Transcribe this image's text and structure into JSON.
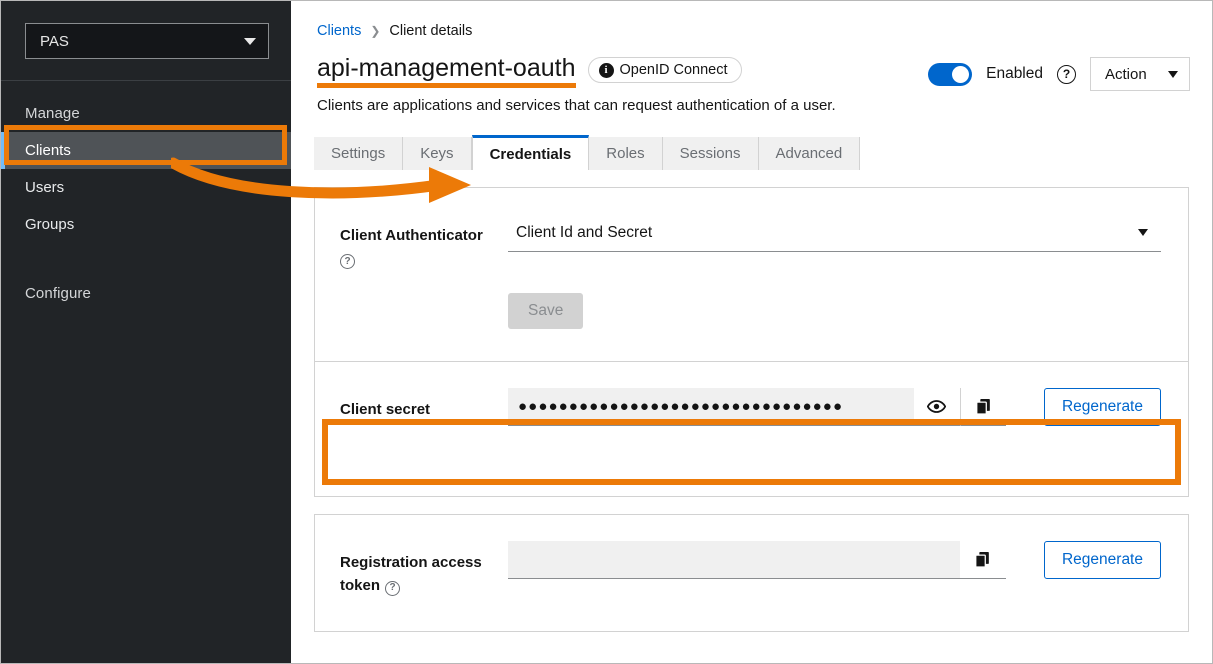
{
  "sidebar": {
    "realm_select": {
      "value": "PAS",
      "icon": "chevron-down-icon"
    },
    "section_label": "Manage",
    "items": [
      {
        "label": "Clients",
        "active": true
      },
      {
        "label": "Users",
        "active": false
      },
      {
        "label": "Groups",
        "active": false
      }
    ],
    "configure_label": "Configure"
  },
  "breadcrumb": {
    "root": "Clients",
    "separator": "❯",
    "current": "Client details"
  },
  "header": {
    "title": "api-management-oauth",
    "badge": {
      "icon": "info-icon",
      "label": "OpenID Connect"
    },
    "toggle": {
      "state": "on",
      "label": "Enabled"
    },
    "help_icon": "question-circle-icon",
    "action_button": {
      "label": "Action",
      "icon": "caret-down-icon"
    },
    "subtitle": "Clients are applications and services that can request authentication of a user."
  },
  "tabs": [
    {
      "label": "Settings",
      "active": false
    },
    {
      "label": "Keys",
      "active": false
    },
    {
      "label": "Credentials",
      "active": true
    },
    {
      "label": "Roles",
      "active": false
    },
    {
      "label": "Sessions",
      "active": false
    },
    {
      "label": "Advanced",
      "active": false
    }
  ],
  "authenticator_card": {
    "label": "Client Authenticator",
    "help_icon": "question-circle-icon",
    "select_value": "Client Id and Secret",
    "select_icon": "caret-down-icon",
    "save_label": "Save"
  },
  "secret_card": {
    "label": "Client secret",
    "value": "●●●●●●●●●●●●●●●●●●●●●●●●●●●●●●●●",
    "show_icon": "eye-icon",
    "copy_icon": "copy-icon",
    "regenerate_label": "Regenerate"
  },
  "token_card": {
    "label_line1": "Registration access",
    "label_line2": "token",
    "help_icon": "question-circle-icon",
    "value": "",
    "copy_icon": "copy-icon",
    "regenerate_label": "Regenerate"
  },
  "colors": {
    "annotation": "#ec7a08",
    "accent_blue": "#0066cc",
    "sidebar_bg": "#212427",
    "active_nav_bg": "#4f5357",
    "nav_accent": "#73bcf7"
  }
}
